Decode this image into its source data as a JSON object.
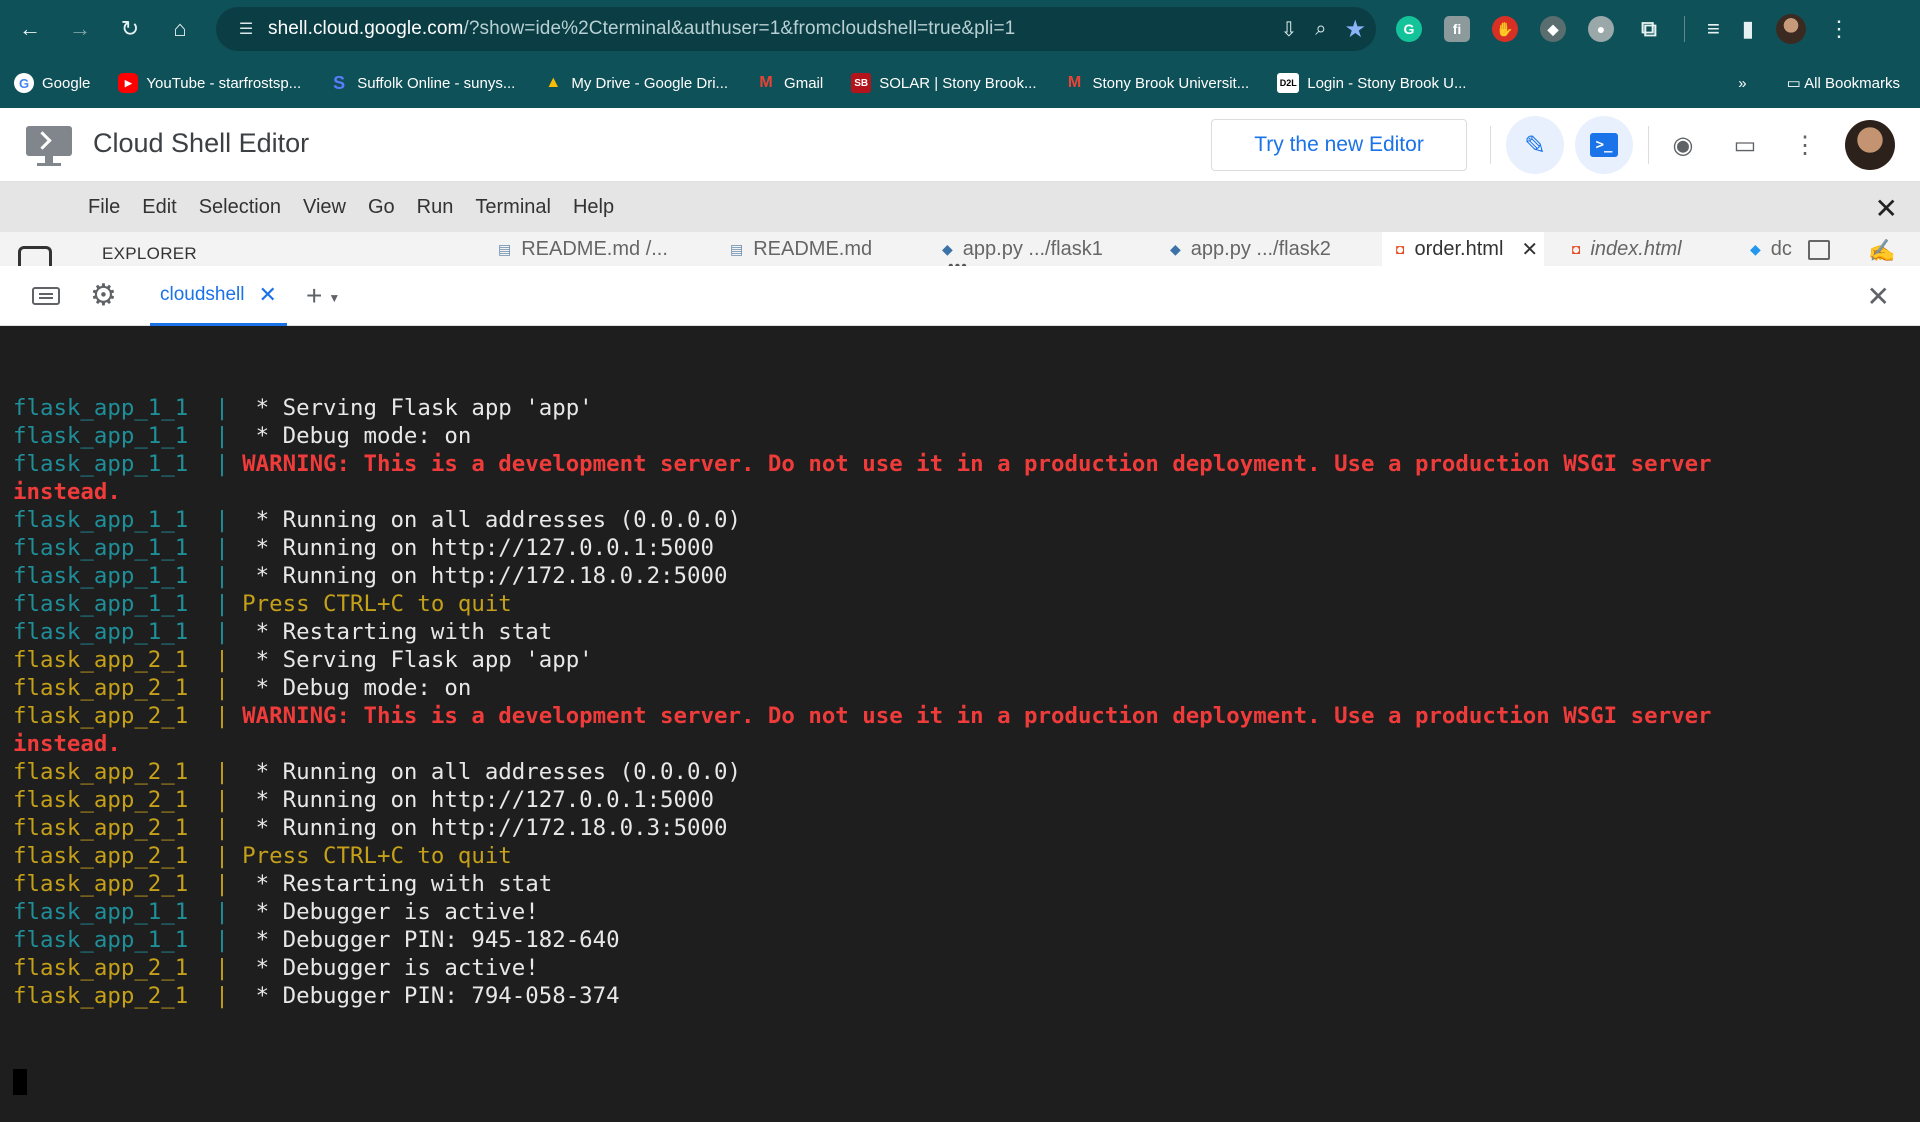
{
  "browser": {
    "url_host": "shell.cloud.google.com",
    "url_rest": "/?show=ide%2Cterminal&authuser=1&fromcloudshell=true&pli=1",
    "bookmarks": [
      {
        "label": "Google",
        "icon": "G"
      },
      {
        "label": "YouTube - starfrostsp...",
        "icon": "▶"
      },
      {
        "label": "Suffolk Online - sunys...",
        "icon": "S"
      },
      {
        "label": "My Drive - Google Dri...",
        "icon": "▲"
      },
      {
        "label": "Gmail",
        "icon": "M"
      },
      {
        "label": "SOLAR | Stony Brook...",
        "icon": "SB"
      },
      {
        "label": "Stony Brook Universit...",
        "icon": "M"
      },
      {
        "label": "Login - Stony Brook U...",
        "icon": "D2L"
      }
    ],
    "all_bookmarks_label": "All Bookmarks",
    "overflow_label": "»"
  },
  "app": {
    "title": "Cloud Shell Editor",
    "try_new_editor_label": "Try the new Editor"
  },
  "menu": {
    "items": [
      "File",
      "Edit",
      "Selection",
      "View",
      "Go",
      "Run",
      "Terminal",
      "Help"
    ]
  },
  "editor": {
    "explorer_label": "EXPLORER",
    "tabs": [
      {
        "name": "README.md /...",
        "icon": "md"
      },
      {
        "name": "README.md",
        "icon": "md"
      },
      {
        "name": "app.py .../flask1",
        "icon": "py"
      },
      {
        "name": "app.py .../flask2",
        "icon": "py"
      },
      {
        "name": "order.html",
        "icon": "html"
      },
      {
        "name": "index.html",
        "icon": "html"
      },
      {
        "name": "dc",
        "icon": "docker"
      }
    ]
  },
  "terminal": {
    "tab_label": "cloudshell",
    "lines": [
      {
        "prefix": "flask_app_1_1  | ",
        "prefix_color": "teal",
        "text": " * Serving Flask app 'app'",
        "text_color": "white"
      },
      {
        "prefix": "flask_app_1_1  | ",
        "prefix_color": "teal",
        "text": " * Debug mode: on",
        "text_color": "white"
      },
      {
        "prefix": "flask_app_1_1  | ",
        "prefix_color": "teal",
        "text": "WARNING: This is a development server. Do not use it in a production deployment. Use a production WSGI server",
        "text_color": "red"
      },
      {
        "prefix": "",
        "prefix_color": "teal",
        "text": "instead.",
        "text_color": "red"
      },
      {
        "prefix": "flask_app_1_1  | ",
        "prefix_color": "teal",
        "text": " * Running on all addresses (0.0.0.0)",
        "text_color": "white"
      },
      {
        "prefix": "flask_app_1_1  | ",
        "prefix_color": "teal",
        "text": " * Running on http://127.0.0.1:5000",
        "text_color": "white"
      },
      {
        "prefix": "flask_app_1_1  | ",
        "prefix_color": "teal",
        "text": " * Running on http://172.18.0.2:5000",
        "text_color": "white"
      },
      {
        "prefix": "flask_app_1_1  | ",
        "prefix_color": "teal",
        "text": "Press CTRL+C to quit",
        "text_color": "yellow"
      },
      {
        "prefix": "flask_app_1_1  | ",
        "prefix_color": "teal",
        "text": " * Restarting with stat",
        "text_color": "white"
      },
      {
        "prefix": "flask_app_2_1  | ",
        "prefix_color": "yellow",
        "text": " * Serving Flask app 'app'",
        "text_color": "white"
      },
      {
        "prefix": "flask_app_2_1  | ",
        "prefix_color": "yellow",
        "text": " * Debug mode: on",
        "text_color": "white"
      },
      {
        "prefix": "flask_app_2_1  | ",
        "prefix_color": "yellow",
        "text": "WARNING: This is a development server. Do not use it in a production deployment. Use a production WSGI server",
        "text_color": "red"
      },
      {
        "prefix": "",
        "prefix_color": "yellow",
        "text": "instead.",
        "text_color": "red"
      },
      {
        "prefix": "flask_app_2_1  | ",
        "prefix_color": "yellow",
        "text": " * Running on all addresses (0.0.0.0)",
        "text_color": "white"
      },
      {
        "prefix": "flask_app_2_1  | ",
        "prefix_color": "yellow",
        "text": " * Running on http://127.0.0.1:5000",
        "text_color": "white"
      },
      {
        "prefix": "flask_app_2_1  | ",
        "prefix_color": "yellow",
        "text": " * Running on http://172.18.0.3:5000",
        "text_color": "white"
      },
      {
        "prefix": "flask_app_2_1  | ",
        "prefix_color": "yellow",
        "text": "Press CTRL+C to quit",
        "text_color": "yellow"
      },
      {
        "prefix": "flask_app_2_1  | ",
        "prefix_color": "yellow",
        "text": " * Restarting with stat",
        "text_color": "white"
      },
      {
        "prefix": "flask_app_1_1  | ",
        "prefix_color": "teal",
        "text": " * Debugger is active!",
        "text_color": "white"
      },
      {
        "prefix": "flask_app_1_1  | ",
        "prefix_color": "teal",
        "text": " * Debugger PIN: 945-182-640",
        "text_color": "white"
      },
      {
        "prefix": "flask_app_2_1  | ",
        "prefix_color": "yellow",
        "text": " * Debugger is active!",
        "text_color": "white"
      },
      {
        "prefix": "flask_app_2_1  | ",
        "prefix_color": "yellow",
        "text": " * Debugger PIN: 794-058-374",
        "text_color": "white"
      }
    ]
  },
  "colors": {
    "chrome_bg": "#0f5158",
    "accent": "#1a73e8",
    "terminal_bg": "#1e1e1e",
    "log_teal": "#1e8f99",
    "log_yellow": "#c5a019",
    "log_red": "#f03b3b"
  }
}
